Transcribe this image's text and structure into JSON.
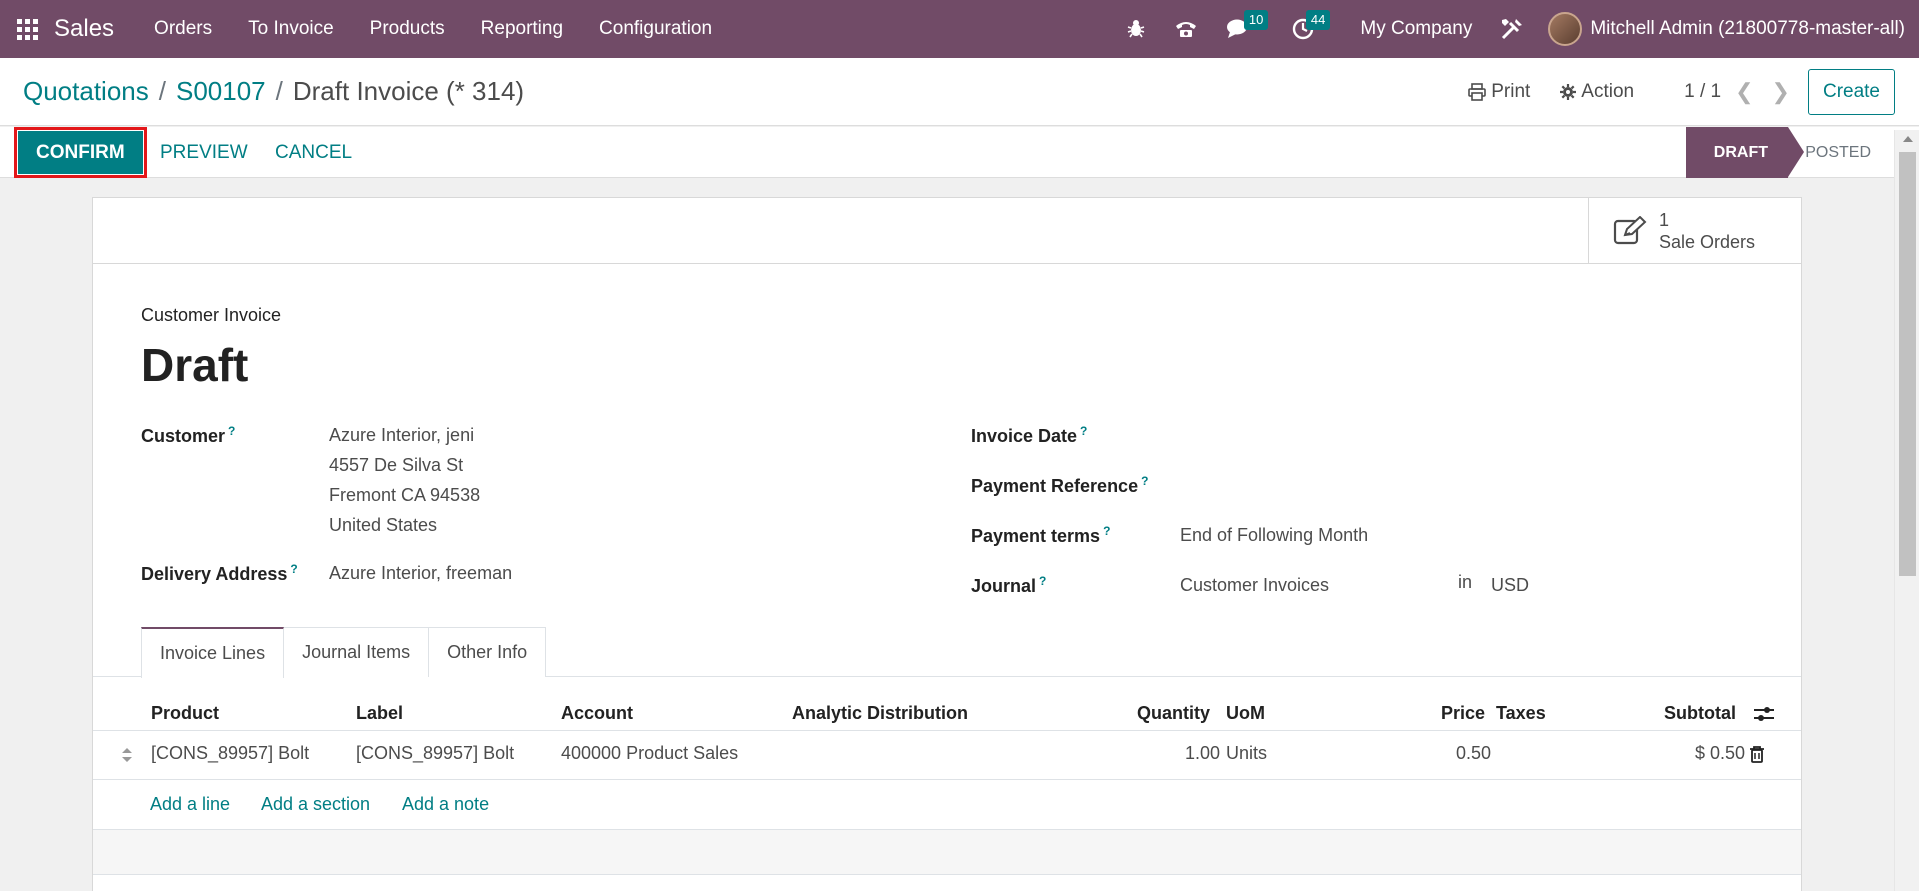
{
  "navbar": {
    "app_name": "Sales",
    "menu": [
      "Orders",
      "To Invoice",
      "Products",
      "Reporting",
      "Configuration"
    ],
    "messages_count": "10",
    "activities_count": "44",
    "company": "My Company",
    "user": "Mitchell Admin (21800778-master-all)"
  },
  "breadcrumb": {
    "items": [
      "Quotations",
      "S00107"
    ],
    "current": "Draft Invoice (* 314)"
  },
  "control_panel": {
    "print_label": "Print",
    "action_label": "Action",
    "pager": "1 / 1",
    "create_label": "Create"
  },
  "statusbar": {
    "confirm_label": "CONFIRM",
    "preview_label": "PREVIEW",
    "cancel_label": "CANCEL",
    "stages": [
      "DRAFT",
      "POSTED"
    ],
    "active_stage": "DRAFT"
  },
  "smart_button": {
    "count": "1",
    "label": "Sale Orders"
  },
  "form": {
    "doc_type": "Customer Invoice",
    "title": "Draft",
    "customer_label": "Customer",
    "customer_lines": [
      "Azure Interior, jeni",
      "4557 De Silva St",
      "Fremont CA 94538",
      "United States"
    ],
    "delivery_label": "Delivery Address",
    "delivery_value": "Azure Interior, freeman",
    "invoice_date_label": "Invoice Date",
    "payment_ref_label": "Payment Reference",
    "payment_terms_label": "Payment terms",
    "payment_terms_value": "End of Following Month",
    "journal_label": "Journal",
    "journal_value": "Customer Invoices",
    "journal_in": "in",
    "currency": "USD",
    "help_mark": "?"
  },
  "tabs": [
    "Invoice Lines",
    "Journal Items",
    "Other Info"
  ],
  "table": {
    "headers": [
      "Product",
      "Label",
      "Account",
      "Analytic Distribution",
      "Quantity",
      "UoM",
      "Price",
      "Taxes",
      "Subtotal"
    ],
    "rows": [
      {
        "product": "[CONS_89957] Bolt",
        "label": "[CONS_89957] Bolt",
        "account": "400000 Product Sales",
        "analytic": "",
        "quantity": "1.00",
        "uom": "Units",
        "price": "0.50",
        "taxes": "",
        "subtotal": "$ 0.50"
      }
    ],
    "add_line": "Add a line",
    "add_section": "Add a section",
    "add_note": "Add a note"
  },
  "colors": {
    "brand": "#714b67",
    "accent": "#017e84",
    "highlight": "#e3171a"
  }
}
